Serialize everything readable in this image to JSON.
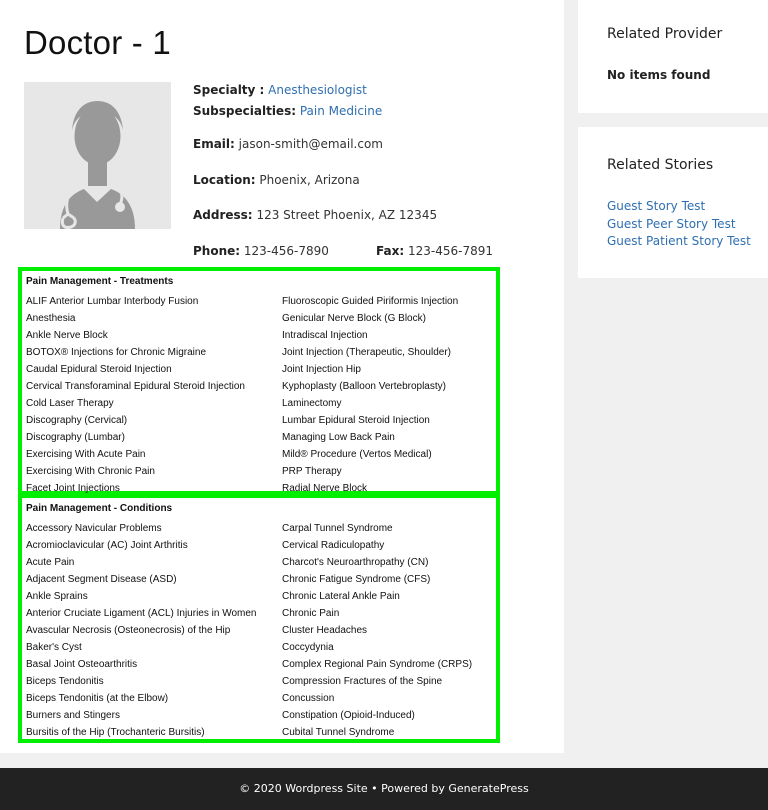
{
  "page": {
    "title": "Doctor - 1"
  },
  "profile": {
    "specialty_label": "Specialty :",
    "specialty": "Anesthesiologist",
    "subspecialties_label": "Subspecialties:",
    "subspecialties": "Pain Medicine",
    "email_label": "Email:",
    "email": "jason-smith@email.com",
    "location_label": "Location:",
    "location": "Phoenix, Arizona",
    "address_label": "Address:",
    "address": "123 Street Phoenix, AZ 12345",
    "phone_label": "Phone:",
    "phone": "123-456-7890",
    "fax_label": "Fax:",
    "fax": "123-456-7891",
    "avatar_icon": "doctor-placeholder-icon"
  },
  "treatments": {
    "title": "Pain Management - Treatments",
    "left": [
      "ALIF Anterior Lumbar Interbody Fusion",
      "Anesthesia",
      "Ankle Nerve Block",
      "BOTOX® Injections for Chronic Migraine",
      "Caudal Epidural Steroid Injection",
      "Cervical Transforaminal Epidural Steroid Injection",
      "Cold Laser Therapy",
      "Discography (Cervical)",
      "Discography (Lumbar)",
      "Exercising With Acute Pain",
      "Exercising With Chronic Pain",
      "Facet Joint Injections"
    ],
    "right": [
      "Fluoroscopic Guided Piriformis Injection",
      "Genicular Nerve Block (G Block)",
      "Intradiscal Injection",
      "Joint Injection (Therapeutic, Shoulder)",
      "Joint Injection Hip",
      "Kyphoplasty (Balloon Vertebroplasty)",
      "Laminectomy",
      "Lumbar Epidural Steroid Injection",
      "Managing Low Back Pain",
      "Mild® Procedure (Vertos Medical)",
      "PRP Therapy",
      "Radial Nerve Block"
    ]
  },
  "conditions": {
    "title": "Pain Management - Conditions",
    "left": [
      "Accessory Navicular Problems",
      "Acromioclavicular (AC) Joint Arthritis",
      "Acute Pain",
      "Adjacent Segment Disease (ASD)",
      "Ankle Sprains",
      "Anterior Cruciate Ligament (ACL) Injuries in Women",
      "Avascular Necrosis (Osteonecrosis) of the Hip",
      "Baker's Cyst",
      "Basal Joint Osteoarthritis",
      "Biceps Tendonitis",
      "Biceps Tendonitis (at the Elbow)",
      "Burners and Stingers",
      "Bursitis of the Hip (Trochanteric Bursitis)"
    ],
    "right": [
      "Carpal Tunnel Syndrome",
      "Cervical Radiculopathy",
      "Charcot's Neuroarthropathy (CN)",
      "Chronic Fatigue Syndrome (CFS)",
      "Chronic Lateral Ankle Pain",
      "Chronic Pain",
      "Cluster Headaches",
      "Coccydynia",
      "Complex Regional Pain Syndrome (CRPS)",
      "Compression Fractures of the Spine",
      "Concussion",
      "Constipation (Opioid-Induced)",
      "Cubital Tunnel Syndrome"
    ]
  },
  "sidebar": {
    "provider_title": "Related Provider",
    "provider_empty": "No items found",
    "stories_title": "Related Stories",
    "stories": [
      "Guest Story Test",
      "Guest Peer Story Test",
      "Guest Patient Story Test"
    ]
  },
  "footer": {
    "text": "© 2020 Wordpress Site • Powered by GeneratePress"
  },
  "colors": {
    "link": "#2f6fb0",
    "highlight_border": "#00ee00",
    "footer_bg": "#222222"
  }
}
